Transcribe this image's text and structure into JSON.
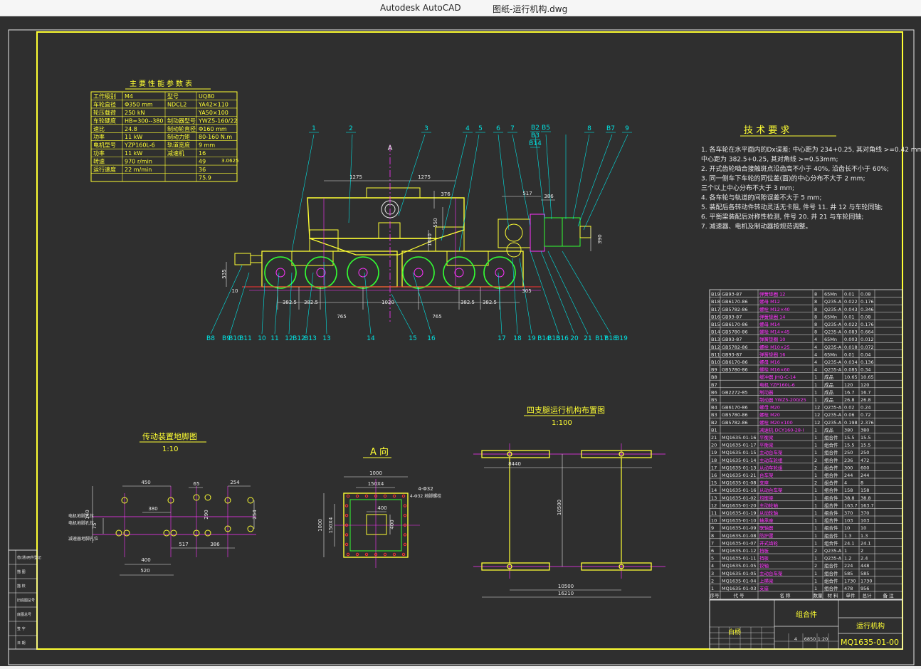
{
  "app": {
    "name": "Autodesk AutoCAD",
    "document": "图纸-运行机构.dwg"
  },
  "colors": {
    "background": "#2f2f2f",
    "frame": "#ffff33",
    "line_white": "#e8e8e8",
    "cyan": "#00e5e5",
    "magenta": "#ff33ff",
    "green": "#33ff33",
    "yellow": "#ffff33",
    "red": "#ff3333"
  },
  "params_table": {
    "title": "主要性能参数表",
    "rows": [
      [
        "工作级别",
        "M4",
        "型号",
        "UQ80"
      ],
      [
        "车轮直径",
        "Φ350 mm",
        "NDCL2",
        "YA42×110"
      ],
      [
        "轮压载荷",
        "250 kN",
        "",
        "YA50×100"
      ],
      [
        "车轮硬度",
        "HB=300--380",
        "制动器型号",
        "YWZ5-160/22"
      ],
      [
        "速比",
        "24.8",
        "制动轮直径",
        "Φ160 mm"
      ],
      [
        "功率",
        "11 kW",
        "制动力矩",
        "80-160 N.m"
      ],
      [
        "电机型号",
        "YZP160L-6",
        "轨道宽度",
        "9 mm"
      ],
      [
        "功率",
        "11 kW",
        "减速机",
        "16"
      ],
      [
        "转速",
        "970 r/min",
        "",
        "49"
      ],
      [
        "运行速度",
        "22 m/min",
        "",
        "36"
      ],
      [
        "",
        "",
        "",
        "75.9"
      ]
    ],
    "ratio": "3.0625"
  },
  "tech_req": {
    "title": "技 术 要 求",
    "lines": [
      "1. 各车轮在水平面内的Dx误差: 中心距为 234+0.25, 其对角线 >=0.42 mm;",
      "    中心距为 382.5+0.25, 其对角线 >=0.53mm;",
      "2. 开式齿轮啮合接触斑点沿齿高不小于 40%, 沿齿长不小于 60%;",
      "3. 同一侧车下车轮的同位差(面)的中心分布不大于 2 mm;",
      "    三个以上中心分布不大于 3 mm;",
      "4. 各车轮与轨道的间隙误差不大于 5 mm;",
      "5. 装配后各转动件转动灵活无卡阻, 件号 11. 井 12 与车轮同轴;",
      "6. 平衡梁装配后对称性检测, 件号 20. 井 21 与车轮同轴;",
      "7. 减速器、电机及制动器按规范调整。"
    ]
  },
  "main_view": {
    "section_label": "A",
    "dims": [
      "1275",
      "1275",
      "376",
      "550",
      "1640",
      "517",
      "386",
      "390",
      "535",
      "382.5",
      "382.5",
      "765",
      "1020",
      "765",
      "382.5",
      "382.5",
      "10",
      "305"
    ],
    "top_callouts": [
      "1",
      "2",
      "3",
      "4",
      "5",
      "6",
      "7",
      "8",
      "B2",
      "B3",
      "B14",
      "B5",
      "B6",
      "8",
      "B7",
      "9"
    ],
    "bottom_callouts": [
      "B8",
      "B9",
      "B10",
      "B11",
      "10",
      "11",
      "12",
      "B12",
      "B13",
      "13",
      "14",
      "15",
      "16",
      "17",
      "18",
      "19",
      "B14",
      "B15",
      "B16",
      "20",
      "21",
      "B17",
      "B18",
      "B19"
    ]
  },
  "view_drive": {
    "title": "传动装置地脚图",
    "scale": "1:10",
    "dims": [
      "450",
      "65",
      "254",
      "380",
      "290",
      "75",
      "254",
      "140",
      "400",
      "520",
      "517",
      "386"
    ],
    "notes": [
      "电机地脚孔位",
      "减速器地脚孔位"
    ]
  },
  "view_a": {
    "title": "A 向",
    "dims": [
      "1000",
      "150X4",
      "400",
      "1000",
      "150X4",
      "400",
      "4-Φ32"
    ],
    "note": "4-Φ32 地脚螺栓"
  },
  "view_layout": {
    "title": "四支腿运行机构布置图",
    "scale": "1:100",
    "dims": [
      "8440",
      "10500",
      "10500",
      "16210"
    ]
  },
  "bom": {
    "rows": [
      [
        "B19",
        "GB93-87",
        "弹簧垫圈 12",
        "8",
        "65Mn",
        "0.01",
        "0.08"
      ],
      [
        "B18",
        "GB6170-86",
        "螺母 M12",
        "8",
        "Q235-A",
        "0.022",
        "0.176"
      ],
      [
        "B17",
        "GB5782-86",
        "螺栓 M12×40",
        "8",
        "Q235-A",
        "0.043",
        "0.346"
      ],
      [
        "B16",
        "GB93-87",
        "弹簧垫圈 14",
        "8",
        "65Mn",
        "0.01",
        "0.08"
      ],
      [
        "B15",
        "GB6170-86",
        "螺母 M14",
        "8",
        "Q235-A",
        "0.022",
        "0.176"
      ],
      [
        "B14",
        "GB5780-86",
        "螺栓 M14×45",
        "8",
        "Q235-A",
        "0.083",
        "0.664"
      ],
      [
        "B13",
        "GB93-87",
        "弹簧垫圈 10",
        "4",
        "65Mn",
        "0.003",
        "0.012"
      ],
      [
        "B12",
        "GB5782-86",
        "螺栓 M10×25",
        "4",
        "Q235-A",
        "0.018",
        "0.072"
      ],
      [
        "B11",
        "GB93-87",
        "弹簧垫圈 16",
        "4",
        "65Mn",
        "0.01",
        "0.04"
      ],
      [
        "B10",
        "GB6170-86",
        "螺母 M16",
        "4",
        "Q235-A",
        "0.034",
        "0.136"
      ],
      [
        "B9",
        "GB5780-86",
        "螺栓 M16×60",
        "4",
        "Q235-A",
        "0.085",
        "0.34"
      ],
      [
        "B8",
        "",
        "缓冲器 JHQ-C-14",
        "1",
        "成品",
        "10.65",
        "10.65"
      ],
      [
        "B7",
        "",
        "电机 YZP160L-6",
        "1",
        "成品",
        "120",
        "120"
      ],
      [
        "B6",
        "GB2272-85",
        "制动器",
        "1",
        "成品",
        "16.7",
        "16.7"
      ],
      [
        "B5",
        "",
        "制动器 YWZ5-200/25",
        "1",
        "成品",
        "26.8",
        "26.8"
      ],
      [
        "B4",
        "GB6170-86",
        "螺母 M20",
        "12",
        "Q235-A",
        "0.02",
        "0.24"
      ],
      [
        "B3",
        "GB5780-86",
        "螺栓 M20",
        "12",
        "Q235-A",
        "0.06",
        "0.72"
      ],
      [
        "B2",
        "GB5782-86",
        "螺栓 M20×100",
        "12",
        "Q235-A",
        "0.198",
        "2.376"
      ],
      [
        "B1",
        "",
        "减速机 DCY160-28-I",
        "1",
        "成品",
        "380",
        "380"
      ],
      [
        "21",
        "MQ1635-01-16",
        "平衡梁",
        "1",
        "组合件",
        "15.5",
        "15.5"
      ],
      [
        "20",
        "MQ1635-01-17",
        "平衡梁",
        "1",
        "组合件",
        "15.5",
        "15.5"
      ],
      [
        "19",
        "MQ1635-01-15",
        "主动台车架",
        "1",
        "组合件",
        "250",
        "250"
      ],
      [
        "18",
        "MQ1635-01-14",
        "主动车轮组",
        "2",
        "组合件",
        "236",
        "472"
      ],
      [
        "17",
        "MQ1635-01-13",
        "从动车轮组",
        "2",
        "组合件",
        "300",
        "600"
      ],
      [
        "16",
        "MQ1635-01-21",
        "台车架",
        "1",
        "组合件",
        "244",
        "244"
      ],
      [
        "15",
        "MQ1635-01-08",
        "支座",
        "2",
        "组合件",
        "4",
        "8"
      ],
      [
        "14",
        "MQ1635-01-16",
        "从动台车架",
        "1",
        "组合件",
        "158",
        "158"
      ],
      [
        "13",
        "MQ1635-01-02",
        "均衡梁",
        "1",
        "组合件",
        "38.8",
        "38.8"
      ],
      [
        "12",
        "MQ1635-01-20",
        "主动轮轴",
        "1",
        "组合件",
        "163.7",
        "163.7"
      ],
      [
        "11",
        "MQ1635-01-19",
        "从动轮轴",
        "1",
        "组合件",
        "370",
        "370"
      ],
      [
        "10",
        "MQ1635-01-10",
        "轴承座",
        "1",
        "组合件",
        "103",
        "103"
      ],
      [
        "9",
        "MQ1635-01-09",
        "联轴器",
        "1",
        "组合件",
        "10",
        "10"
      ],
      [
        "8",
        "MQ1635-01-08",
        "防护罩",
        "1",
        "组合件",
        "1.3",
        "1.3"
      ],
      [
        "7",
        "MQ1635-01-07",
        "开式齿轮",
        "1",
        "组合件",
        "24.1",
        "24.1"
      ],
      [
        "6",
        "MQ1635-01-12",
        "挡板",
        "2",
        "Q235-A",
        "1",
        "2"
      ],
      [
        "5",
        "MQ1635-01-11",
        "挡板",
        "1",
        "Q235-A",
        "1.2",
        "2.4"
      ],
      [
        "4",
        "MQ1635-01-05",
        "铰轴",
        "2",
        "组合件",
        "224",
        "448"
      ],
      [
        "3",
        "MQ1635-01-05",
        "主动台车架",
        "1",
        "组合件",
        "585",
        "585"
      ],
      [
        "2",
        "MQ1635-01-04",
        "上横梁",
        "1",
        "组合件",
        "1730",
        "1730"
      ],
      [
        "1",
        "MQ1635-01-03",
        "支座",
        "1",
        "组合件",
        "478",
        "956"
      ]
    ],
    "header": [
      "序号",
      "代 号",
      "名 称",
      "数量",
      "材 料",
      "单件",
      "总计",
      "备 注"
    ]
  },
  "title_block": {
    "assembly": "组合件",
    "name": "运行机构",
    "drawing_no": "MQ1635-01-00",
    "weight": "6850",
    "scale": "1:20",
    "qty": "4",
    "designer": "白杨"
  },
  "left_strip": {
    "labels": [
      "借(通)用件登记",
      "描 图",
      "描 校",
      "旧底图总号",
      "底图总号",
      "签 字",
      "日 期"
    ]
  }
}
